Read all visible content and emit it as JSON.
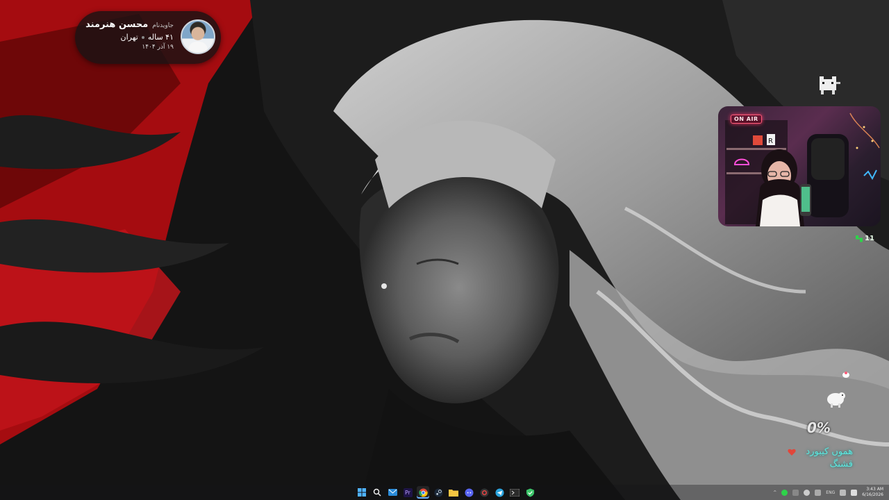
{
  "profile": {
    "tag": "جاویدنام",
    "name": "محسن هنرمند",
    "age": "۴۱ ساله",
    "city": "تهران",
    "date": "۱۹ آذر ۱۴۰۴"
  },
  "webcam": {
    "on_air": "ON AIR",
    "sign_letter": "R"
  },
  "counter": {
    "value": "11"
  },
  "widgets": {
    "percent": "0%",
    "fa_text_line1": "هموں کیبورد",
    "fa_text_line2": "قشنگ"
  },
  "taskbar": {
    "apps": [
      "start",
      "search",
      "mail",
      "premiere",
      "chrome",
      "steam",
      "files",
      "discord",
      "browser",
      "telegram",
      "terminal",
      "edge"
    ],
    "premiere_label": "Pr",
    "language": "ENG",
    "time": "3:43 AM",
    "date": "6/16/2026"
  },
  "colors": {
    "accent_red": "#b50d12",
    "cyan_text": "#5de8e0",
    "counter_green": "#2ed34a"
  }
}
